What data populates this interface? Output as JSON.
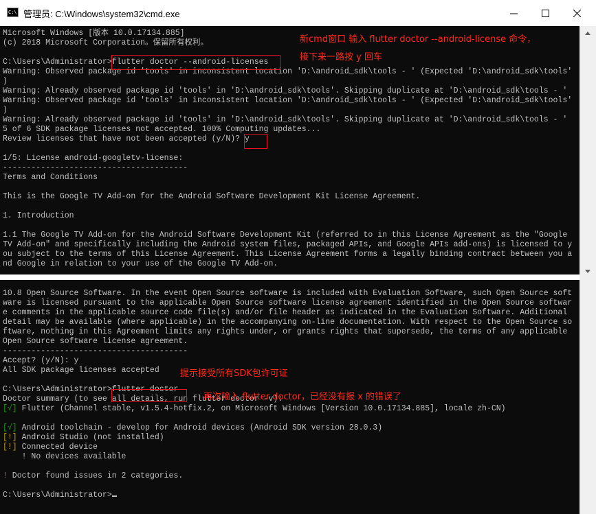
{
  "window": {
    "title": "管理员: C:\\Windows\\system32\\cmd.exe",
    "app_icon_text": "C:\\"
  },
  "console_top": {
    "l01": "Microsoft Windows [版本 10.0.17134.885]",
    "l02": "(c) 2018 Microsoft Corporation。保留所有权利。",
    "l03": "",
    "l04": "C:\\Users\\Administrator>flutter doctor --android-licenses",
    "l05": "Warning: Observed package id 'tools' in inconsistent location 'D:\\android_sdk\\tools - ' (Expected 'D:\\android_sdk\\tools'",
    "l06": ")",
    "l07": "Warning: Already observed package id 'tools' in 'D:\\android_sdk\\tools'. Skipping duplicate at 'D:\\android_sdk\\tools - '",
    "l08": "Warning: Observed package id 'tools' in inconsistent location 'D:\\android_sdk\\tools - ' (Expected 'D:\\android_sdk\\tools'",
    "l09": ")",
    "l10": "Warning: Already observed package id 'tools' in 'D:\\android_sdk\\tools'. Skipping duplicate at 'D:\\android_sdk\\tools - '",
    "l11": "5 of 6 SDK package licenses not accepted. 100% Computing updates...",
    "l12": "Review licenses that have not been accepted (y/N)? y",
    "l13": "",
    "l14": "1/5: License android-googletv-license:",
    "l15": "---------------------------------------",
    "l16": "Terms and Conditions",
    "l17": "",
    "l18": "This is the Google TV Add-on for the Android Software Development Kit License Agreement.",
    "l19": "",
    "l20": "1. Introduction",
    "l21": "",
    "l22": "1.1 The Google TV Add-on for the Android Software Development Kit (referred to in this License Agreement as the \"Google",
    "l23": "TV Add-on\" and specifically including the Android system files, packaged APIs, and Google APIs add-ons) is licensed to y",
    "l24": "ou subject to the terms of this License Agreement. This License Agreement forms a legally binding contract between you a",
    "l25": "nd Google in relation to your use of the Google TV Add-on."
  },
  "console_bottom": {
    "m01": "10.8 Open Source Software. In the event Open Source software is included with Evaluation Software, such Open Source soft",
    "m02": "ware is licensed pursuant to the applicable Open Source software license agreement identified in the Open Source softwar",
    "m03": "e comments in the applicable source code file(s) and/or file header as indicated in the Evaluation Software. Additional",
    "m04": "detail may be available (where applicable) in the accompanying on-line documentation. With respect to the Open Source so",
    "m05": "ftware, nothing in this Agreement limits any rights under, or grants rights that supersede, the terms of any applicable",
    "m06": "Open Source software license agreement.",
    "m07": "---------------------------------------",
    "m08": "Accept? (y/N): y",
    "m09": "All SDK package licenses accepted",
    "m10": "",
    "m11": "C:\\Users\\Administrator>flutter doctor",
    "m12": "Doctor summary (to see all details, run flutter doctor -v):",
    "m13_mark": "[√]",
    "m13": " Flutter (Channel stable, v1.5.4-hotfix.2, on Microsoft Windows [Version 10.0.17134.885], locale zh-CN)",
    "m14": "",
    "m15_mark": "[√]",
    "m15": " Android toolchain - develop for Android devices (Android SDK version 28.0.3)",
    "m16_mark": "[!]",
    "m16": " Android Studio (not installed)",
    "m17_mark": "[!]",
    "m17": " Connected device",
    "m18_mark": "    !",
    "m18": " No devices available",
    "m19": "",
    "m20_mark": "!",
    "m20": " Doctor found issues in 2 categories.",
    "m21": "",
    "m22": "C:\\Users\\Administrator>"
  },
  "annotations": {
    "note1_line1": "新cmd窗口 输入 flutter doctor --android-license 命令，",
    "note1_line2": "接下来一路按  y  回车",
    "note2": "提示接受所有SDK包许可证",
    "note3": "再次输入 flutter doctor，已经没有报 x  的错误了"
  },
  "colors": {
    "console_bg": "#0c0c0c",
    "console_text": "#c0c0c0",
    "annotation_red": "#ff2a1a",
    "ok_green": "#13a10e",
    "warn_yellow": "#c19c00"
  }
}
